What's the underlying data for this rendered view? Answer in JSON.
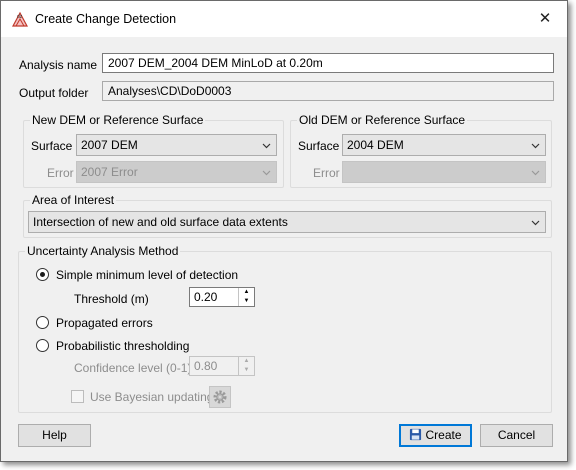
{
  "window": {
    "title": "Create Change Detection",
    "close_symbol": "✕"
  },
  "fields": {
    "analysis_name_label": "Analysis name",
    "analysis_name_value": "2007 DEM_2004 DEM MinLoD at 0.20m",
    "output_folder_label": "Output folder",
    "output_folder_value": "Analyses\\CD\\DoD0003"
  },
  "new_dem": {
    "legend": "New DEM or Reference Surface",
    "surface_label": "Surface",
    "surface_value": "2007 DEM",
    "error_label": "Error",
    "error_value": "2007 Error"
  },
  "old_dem": {
    "legend": "Old DEM or Reference Surface",
    "surface_label": "Surface",
    "surface_value": "2004 DEM",
    "error_label": "Error",
    "error_value": ""
  },
  "area_of_interest": {
    "legend": "Area of Interest",
    "value": "Intersection of new and old surface data extents"
  },
  "uncertainty": {
    "legend": "Uncertainty Analysis Method",
    "simple_label": "Simple minimum level of detection",
    "simple_selected": true,
    "threshold_label": "Threshold (m)",
    "threshold_value": "0.20",
    "propagated_label": "Propagated errors",
    "probabilistic_label": "Probabilistic thresholding",
    "confidence_label": "Confidence level (0-1)",
    "confidence_value": "0.80",
    "bayesian_label": "Use Bayesian updating"
  },
  "buttons": {
    "help": "Help",
    "create": "Create",
    "cancel": "Cancel"
  },
  "icons": {
    "app": "change-detection-icon",
    "close": "close-icon",
    "dropdown": "chevron-down-icon",
    "spin_up": "spin-up-icon",
    "spin_down": "spin-down-icon",
    "settings": "gear-icon",
    "save": "save-icon"
  },
  "colors": {
    "accent": "#0078d7",
    "window_bg": "#f0f0f0",
    "disabled_text": "#8d8d8d"
  }
}
